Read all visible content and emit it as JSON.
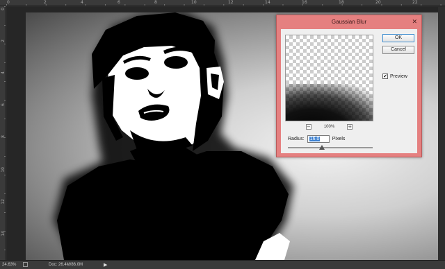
{
  "rulers": {
    "top_ticks": [
      "0",
      "2",
      "4",
      "6",
      "8",
      "10",
      "12",
      "14",
      "16",
      "18",
      "20",
      "22"
    ],
    "left_ticks": [
      "0",
      "2",
      "4",
      "6",
      "8",
      "10",
      "12",
      "14"
    ]
  },
  "dialog": {
    "title": "Gaussian Blur",
    "close_glyph": "✕",
    "ok_label": "OK",
    "cancel_label": "Cancel",
    "preview_label": "Preview",
    "preview_checked_glyph": "✔",
    "preview_checked": true,
    "zoom_out_glyph": "−",
    "zoom_in_glyph": "+",
    "zoom_level": "100%",
    "radius_label": "Radius:",
    "radius_value": "16.0",
    "radius_unit": "Pixels",
    "radius_slider_fraction": 0.4
  },
  "status": {
    "zoom": "24.63%",
    "doc_info": "Doc: 26.4M/86.0M",
    "arrow_glyph": "▶"
  },
  "colors": {
    "dialog_frame": "#e58080",
    "workspace": "#2b2b2b",
    "selection": "#3a7fd0"
  }
}
